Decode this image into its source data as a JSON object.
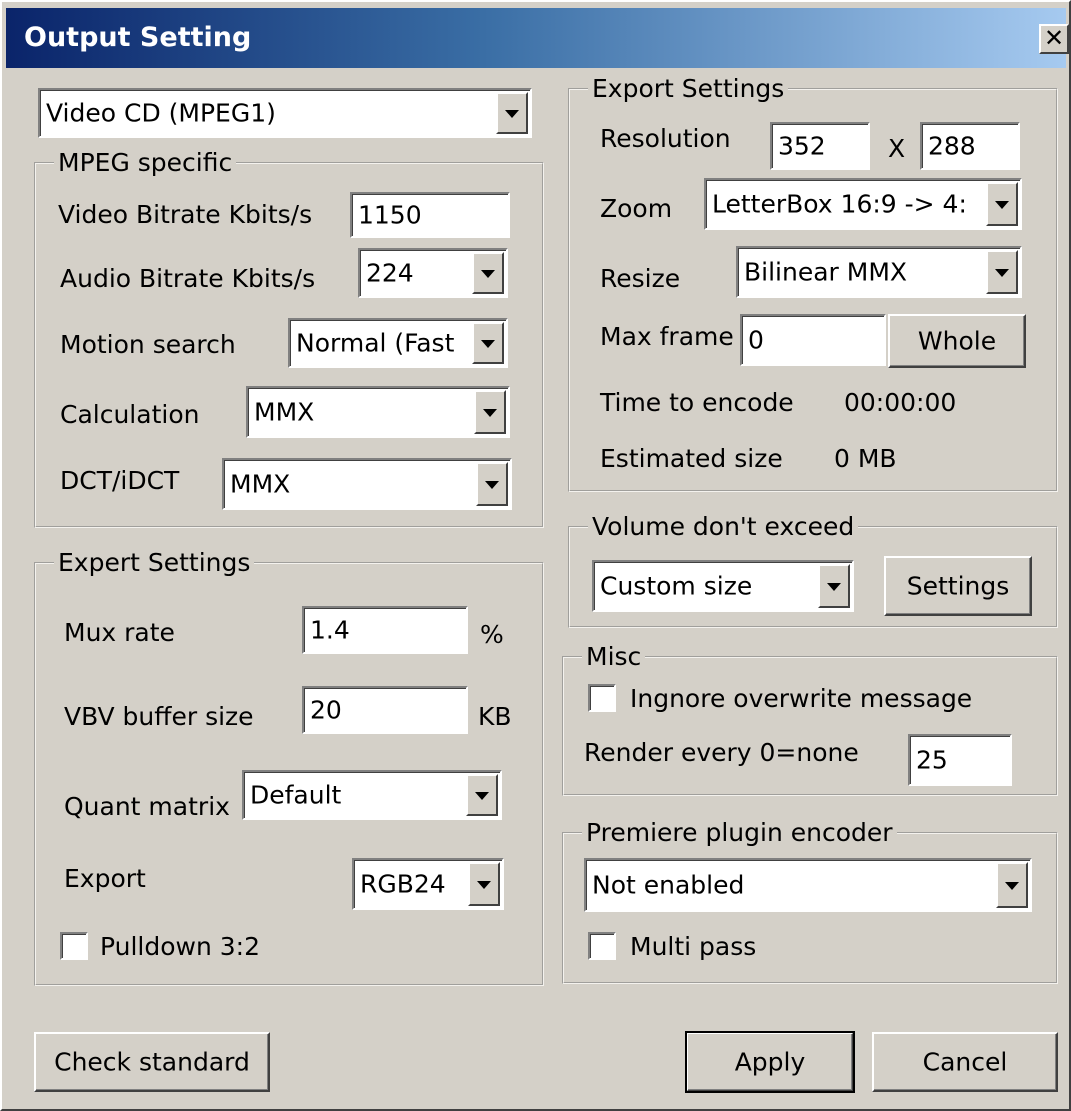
{
  "window": {
    "title": "Output Setting",
    "close_glyph": "✕"
  },
  "format_select": {
    "value": "Video CD (MPEG1)"
  },
  "mpeg": {
    "legend": "MPEG specific",
    "video_bitrate_label": "Video Bitrate Kbits/s",
    "video_bitrate": "1150",
    "audio_bitrate_label": "Audio Bitrate Kbits/s",
    "audio_bitrate": "224",
    "motion_label": "Motion search",
    "motion": "Normal (Fast",
    "calc_label": "Calculation",
    "calc": "MMX",
    "dct_label": "DCT/iDCT",
    "dct": "MMX"
  },
  "expert": {
    "legend": "Expert Settings",
    "mux_label": "Mux rate",
    "mux": "1.4",
    "mux_unit": "%",
    "vbv_label": "VBV buffer size",
    "vbv": "20",
    "vbv_unit": "KB",
    "quant_label": "Quant matrix",
    "quant": "Default",
    "export_label": "Export",
    "export": "RGB24",
    "pulldown_label": "Pulldown 3:2"
  },
  "export": {
    "legend": "Export Settings",
    "resolution_label": "Resolution",
    "res_w": "352",
    "res_x": "X",
    "res_h": "288",
    "zoom_label": "Zoom",
    "zoom": "LetterBox 16:9 -> 4:",
    "resize_label": "Resize",
    "resize": "Bilinear MMX",
    "maxframe_label": "Max frame",
    "maxframe": "0",
    "whole_button": "Whole",
    "time_label": "Time to encode",
    "time": "00:00:00",
    "size_label": "Estimated size",
    "size": "0 MB"
  },
  "volume": {
    "legend": "Volume don't exceed",
    "select": "Custom size",
    "settings_button": "Settings"
  },
  "misc": {
    "legend": "Misc",
    "ignore_label": "Ingnore overwrite message",
    "render_label": "Render every 0=none",
    "render": "25"
  },
  "premiere": {
    "legend": "Premiere plugin encoder",
    "select": "Not enabled",
    "multipass_label": "Multi pass"
  },
  "footer": {
    "check_button": "Check standard",
    "apply_button": "Apply",
    "cancel_button": "Cancel"
  }
}
